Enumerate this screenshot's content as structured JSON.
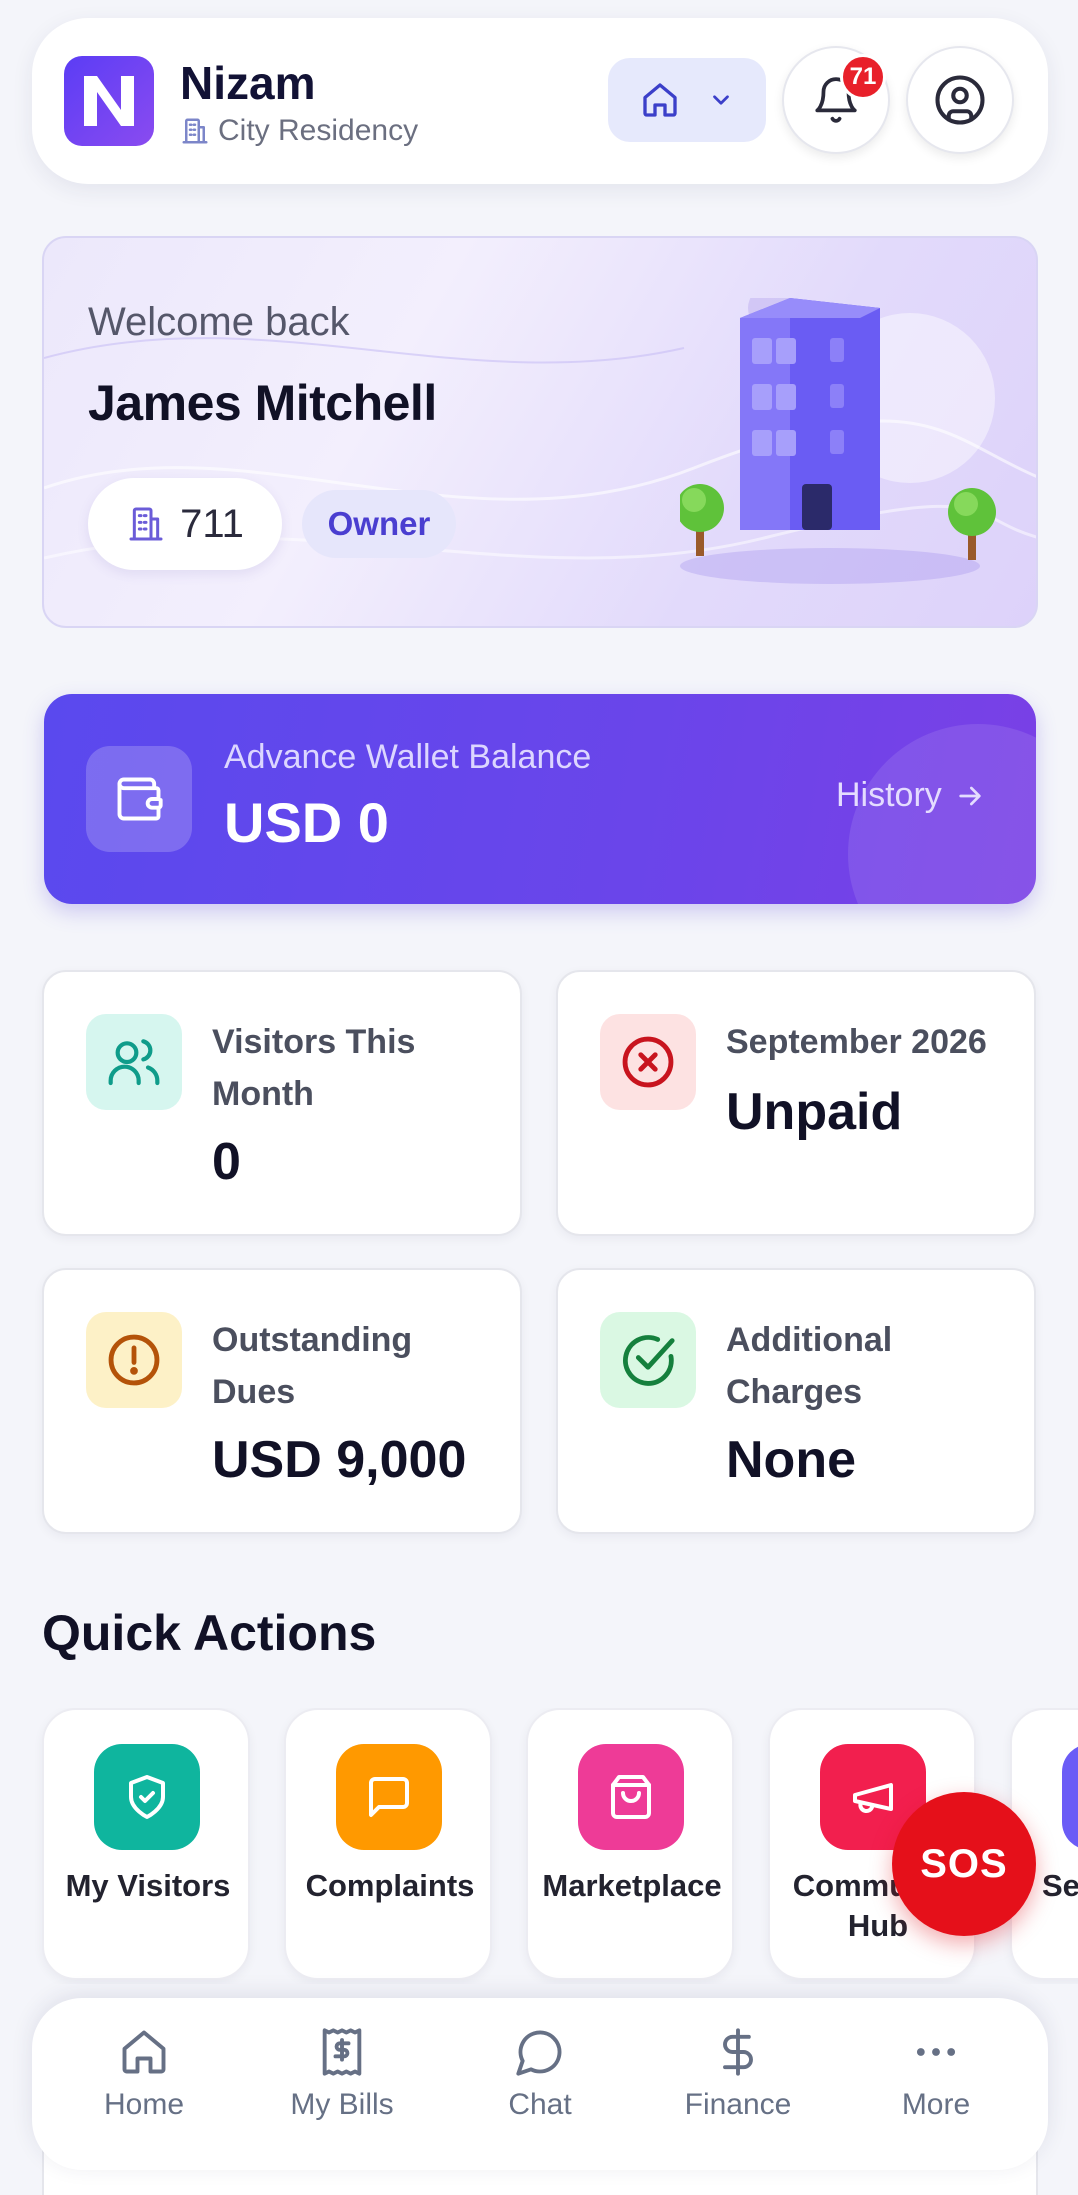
{
  "header": {
    "app_name": "Nizam",
    "community_name": "City Residency",
    "notification_count": "71"
  },
  "welcome": {
    "greeting": "Welcome back",
    "user_name": "James Mitchell",
    "unit_number": "711",
    "role": "Owner"
  },
  "wallet": {
    "label": "Advance Wallet Balance",
    "amount": "USD 0",
    "history_label": "History"
  },
  "stats": {
    "visitors": {
      "label": "Visitors This Month",
      "value": "0",
      "icon": "users-icon",
      "accent": "#0f9c8a"
    },
    "bill": {
      "label": "September 2026",
      "value": "Unpaid",
      "icon": "x-circle-icon",
      "accent": "#c8141e"
    },
    "dues": {
      "label": "Outstanding Dues",
      "value": "USD 9,000",
      "icon": "alert-circle-icon",
      "accent": "#b45309"
    },
    "charges": {
      "label": "Additional Charges",
      "value": "None",
      "icon": "check-circle-icon",
      "accent": "#15803d"
    }
  },
  "quick_actions": {
    "title": "Quick Actions",
    "items": [
      {
        "label": "My Visitors",
        "icon": "shield-check-icon",
        "color": "#0fb59e"
      },
      {
        "label": "Complaints",
        "icon": "message-square-icon",
        "color": "#ff9900"
      },
      {
        "label": "Marketplace",
        "icon": "shopping-bag-icon",
        "color": "#ee3b97"
      },
      {
        "label": "Community Hub",
        "icon": "megaphone-icon",
        "color": "#f21f4e"
      },
      {
        "label": "Se",
        "icon": "partial-icon",
        "color": "#6b5cf6"
      }
    ]
  },
  "sos_label": "SOS",
  "bottom_nav": [
    {
      "label": "Home",
      "icon": "home-icon"
    },
    {
      "label": "My Bills",
      "icon": "receipt-icon"
    },
    {
      "label": "Chat",
      "icon": "chat-bubble-icon"
    },
    {
      "label": "Finance",
      "icon": "dollar-icon"
    },
    {
      "label": "More",
      "icon": "more-dots-icon"
    }
  ]
}
